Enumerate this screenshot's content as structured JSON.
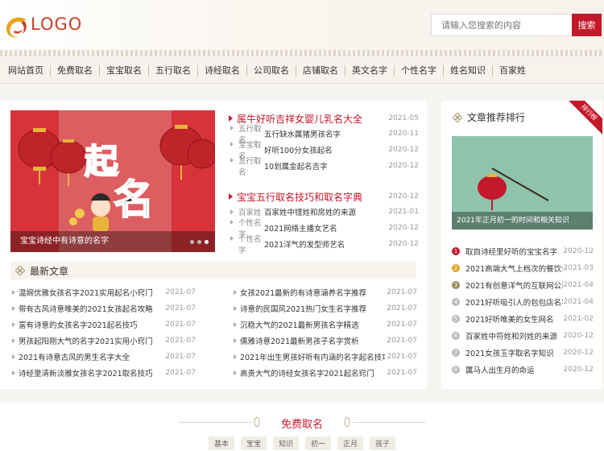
{
  "header": {
    "logo_text": "LOGO",
    "search_placeholder": "请输入您搜索的内容",
    "search_button": "搜索",
    "accent_color": "#c4182b"
  },
  "nav": [
    "网站首页",
    "免费取名",
    "宝宝取名",
    "五行取名",
    "诗经取名",
    "公司取名",
    "店铺取名",
    "英文名字",
    "个性名字",
    "姓名知识",
    "百家姓"
  ],
  "banner": {
    "caption": "宝宝诗经中有诗意的名字",
    "big_chars": [
      "起",
      "名"
    ]
  },
  "topics": [
    {
      "title": "属牛好听吉祥女婴儿乳名大全",
      "date": "2021-05",
      "rows": [
        {
          "cat": "五行取名",
          "title": "五行缺水属猪男孩名字",
          "date": "2020-11"
        },
        {
          "cat": "宝宝取名",
          "title": "好听100分女孩起名",
          "date": "2020-12"
        },
        {
          "cat": "五行取名",
          "title": "10划属金起名吉字",
          "date": "2020-12"
        }
      ]
    },
    {
      "title": "宝宝五行取名技巧和取名字典",
      "date": "2020-12",
      "rows": [
        {
          "cat": "百家姓",
          "title": "百家姓中铿姓和房姓的来源",
          "date": "2021-01"
        },
        {
          "cat": "个性名字",
          "title": "2021网络主播女艺名",
          "date": "2020-12"
        },
        {
          "cat": "个性名字",
          "title": "2021洋气的发型师艺名",
          "date": "2020-12"
        }
      ]
    }
  ],
  "latest": {
    "title": "最新文章",
    "left": [
      {
        "title": "温婉优雅女孩名字2021实用起名小窍门",
        "date": "2021-07"
      },
      {
        "title": "带有古风诗意唯美的2021女孩起名攻略",
        "date": "2021-07"
      },
      {
        "title": "富有诗意的女孩名字2021起名技巧",
        "date": "2021-07"
      },
      {
        "title": "男孩起阳刚大气的名字2021实用小窍门",
        "date": "2021-07"
      },
      {
        "title": "2021有诗意古风的男生名字大全",
        "date": "2021-07"
      },
      {
        "title": "诗经里清新淡雅女孩名字2021取名技巧",
        "date": "2021-07"
      }
    ],
    "right": [
      {
        "title": "女孩2021最新的有诗意涵养名字推荐",
        "date": "2021-07"
      },
      {
        "title": "诗意的民国风2021热门女生名字推荐",
        "date": "2021-07"
      },
      {
        "title": "沉稳大气的2021最新男孩名字精选",
        "date": "2021-07"
      },
      {
        "title": "儒雅诗意2021最新男孩子名字赏析",
        "date": "2021-07"
      },
      {
        "title": "2021年出生男孩好听有内涵的名字起名技巧",
        "date": "2021-07"
      },
      {
        "title": "高贵大气的诗经女孩名字2021起名窍门",
        "date": "2021-07"
      }
    ]
  },
  "sidebar": {
    "title": "文章推荐排行",
    "ribbon": "排行榜",
    "image_caption": "2021年正月初一的时间和相关知识",
    "rank": [
      {
        "n": "1",
        "title": "取自诗经里好听的宝宝名字",
        "date": "2020-12",
        "color": "#c4182b"
      },
      {
        "n": "2",
        "title": "2021高端大气上档次的餐饮公...",
        "date": "2021-03",
        "color": "#e3a32b"
      },
      {
        "n": "3",
        "title": "2021有创意洋气的互联网公司...",
        "date": "2021-04",
        "color": "#9c8b5a"
      },
      {
        "n": "4",
        "title": "2021好听吸引人的包包店名字",
        "date": "2021-04",
        "color": "#bbbbbb"
      },
      {
        "n": "5",
        "title": "2021好听唯美的女生网名",
        "date": "2021-02",
        "color": "#bbbbbb"
      },
      {
        "n": "6",
        "title": "百家姓中符姓和刘姓的来源",
        "date": "2020-12",
        "color": "#bbbbbb"
      },
      {
        "n": "7",
        "title": "2021女孩玉字取名字知识",
        "date": "2020-12",
        "color": "#bbbbbb"
      },
      {
        "n": "8",
        "title": "属马人出生月的命运",
        "date": "2020-12",
        "color": "#bbbbbb"
      }
    ]
  },
  "bottom": {
    "title": "免费取名",
    "tags": [
      "基本",
      "宝宝",
      "知识",
      "初一",
      "正月",
      "孩子"
    ]
  }
}
